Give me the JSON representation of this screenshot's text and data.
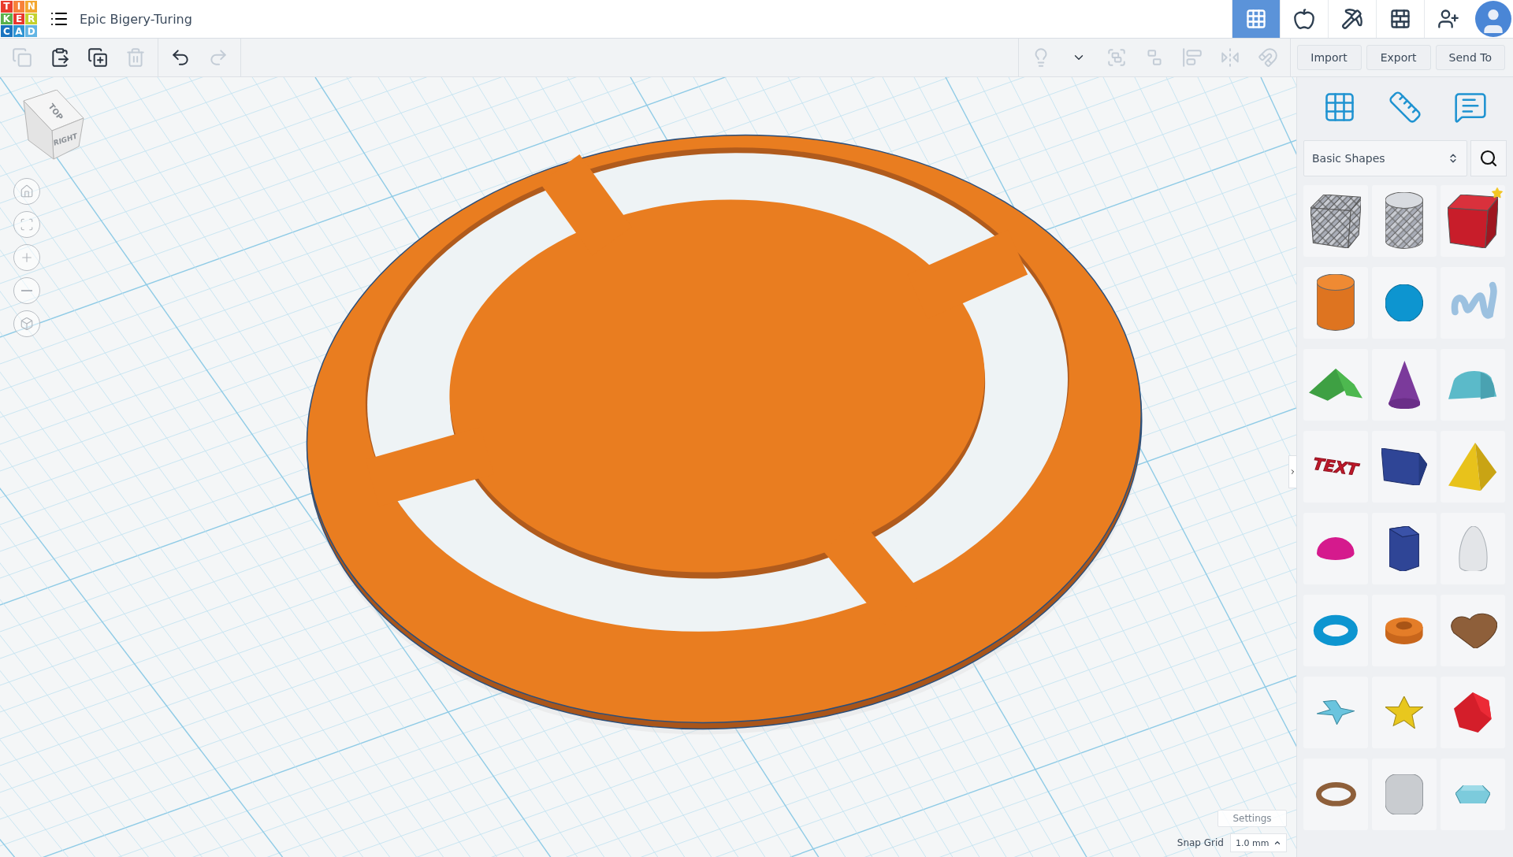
{
  "logo": {
    "letters": [
      "T",
      "I",
      "N",
      "K",
      "E",
      "R",
      "C",
      "A",
      "D"
    ]
  },
  "title": "Epic Bigery-Turing",
  "nav": [
    {
      "kind": "design",
      "selected": true
    },
    {
      "kind": "sim",
      "selected": false
    },
    {
      "kind": "build",
      "selected": false
    },
    {
      "kind": "bricks",
      "selected": false
    },
    {
      "kind": "invite",
      "selected": false
    }
  ],
  "edit_tools": [
    {
      "kind": "copy",
      "disabled": true
    },
    {
      "kind": "paste",
      "disabled": false
    },
    {
      "kind": "duplicate",
      "disabled": false
    },
    {
      "kind": "delete",
      "disabled": true
    }
  ],
  "history_tools": [
    {
      "kind": "undo",
      "disabled": false
    },
    {
      "kind": "redo",
      "disabled": true
    }
  ],
  "shape_tools": [
    {
      "kind": "light",
      "disabled": true
    },
    {
      "kind": "caret",
      "disabled": false
    },
    {
      "kind": "group",
      "disabled": true
    },
    {
      "kind": "ungroup",
      "disabled": true
    },
    {
      "kind": "align",
      "disabled": true
    },
    {
      "kind": "mirror",
      "disabled": true
    },
    {
      "kind": "magnet",
      "disabled": true
    }
  ],
  "actions": [
    "Import",
    "Export",
    "Send To"
  ],
  "view_cube": {
    "top": "TOP",
    "right": "RIGHT"
  },
  "view_controls": [
    {
      "kind": "home"
    },
    {
      "kind": "fit"
    },
    {
      "kind": "zoom-in"
    },
    {
      "kind": "zoom-out"
    },
    {
      "kind": "perspective"
    }
  ],
  "panel_tools": [
    {
      "kind": "workplane"
    },
    {
      "kind": "ruler"
    },
    {
      "kind": "notes"
    }
  ],
  "library": {
    "value": "Basic Shapes"
  },
  "shapes": [
    {
      "kind": "box-hole",
      "favorite": false
    },
    {
      "kind": "cylinder-hole",
      "favorite": false
    },
    {
      "kind": "box",
      "favorite": true
    },
    {
      "kind": "cylinder",
      "favorite": false
    },
    {
      "kind": "sphere",
      "favorite": false
    },
    {
      "kind": "scribble",
      "favorite": false
    },
    {
      "kind": "roof",
      "favorite": false
    },
    {
      "kind": "cone",
      "favorite": false
    },
    {
      "kind": "round-roof",
      "favorite": false
    },
    {
      "kind": "text",
      "favorite": false,
      "label": "TEXT"
    },
    {
      "kind": "wedge",
      "favorite": false
    },
    {
      "kind": "pyramid",
      "favorite": false
    },
    {
      "kind": "half-sphere",
      "favorite": false
    },
    {
      "kind": "polygon",
      "favorite": false
    },
    {
      "kind": "paraboloid",
      "favorite": false
    },
    {
      "kind": "torus",
      "favorite": false
    },
    {
      "kind": "tube",
      "favorite": false
    },
    {
      "kind": "heart",
      "favorite": false
    },
    {
      "kind": "star",
      "favorite": false
    },
    {
      "kind": "star-prism",
      "favorite": false
    },
    {
      "kind": "icosahedron",
      "favorite": false
    },
    {
      "kind": "ring",
      "favorite": false
    },
    {
      "kind": "rounded-cube",
      "favorite": false
    },
    {
      "kind": "gem",
      "favorite": false
    }
  ],
  "settings": "Settings",
  "snap_grid": {
    "label": "Snap Grid",
    "value": "1.0 mm"
  }
}
